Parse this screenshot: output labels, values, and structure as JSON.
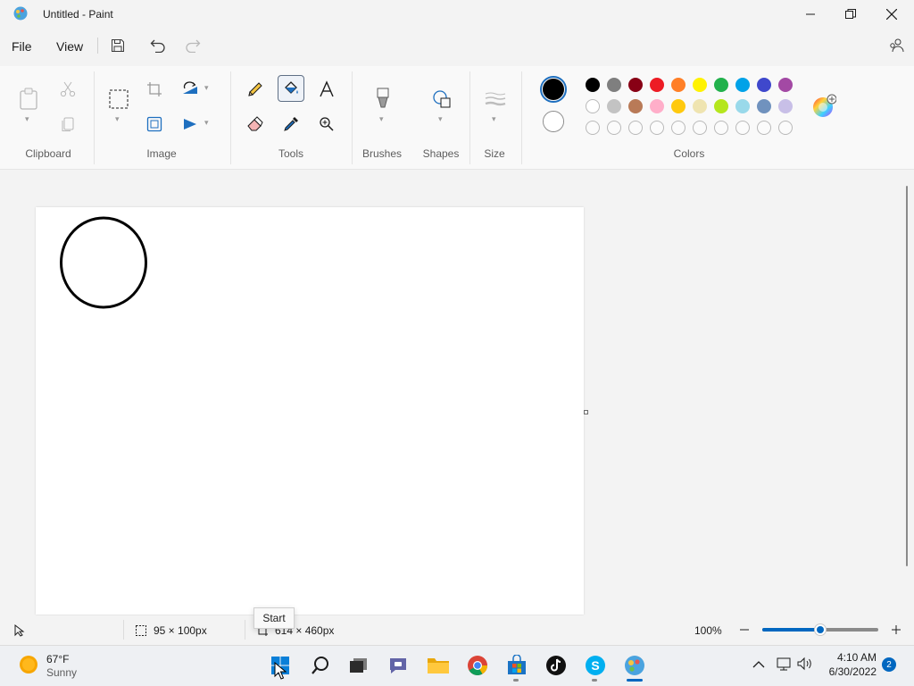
{
  "window": {
    "title": "Untitled - Paint",
    "controls": [
      "minimize",
      "maximize",
      "close"
    ]
  },
  "menu": {
    "file_label": "File",
    "view_label": "View"
  },
  "ribbon": {
    "groups": {
      "clipboard": "Clipboard",
      "image": "Image",
      "tools": "Tools",
      "brushes": "Brushes",
      "shapes": "Shapes",
      "size": "Size",
      "colors": "Colors"
    },
    "active_tool": "fill-bucket",
    "primary_color": "#000000",
    "secondary_color": "#ffffff",
    "palette_row1": [
      "#000000",
      "#7f7f7f",
      "#880015",
      "#ed1c24",
      "#ff7f27",
      "#fff200",
      "#22b14c",
      "#00a2e8",
      "#3f48cc",
      "#a349a4"
    ],
    "palette_row2": [
      "#ffffff",
      "#c3c3c3",
      "#b97a57",
      "#ffaec9",
      "#ffc90e",
      "#efe4b0",
      "#b5e61d",
      "#99d9ea",
      "#7092be",
      "#c8bfe7"
    ],
    "palette_row3_count": 10
  },
  "status": {
    "selection_size": "95 × 100px",
    "canvas_size": "614 × 460px",
    "zoom": "100%",
    "zoom_level_fraction": 0.5
  },
  "tooltip": {
    "text": "Start"
  },
  "taskbar": {
    "weather_temp": "67°F",
    "weather_desc": "Sunny",
    "time": "4:10 AM",
    "date": "6/30/2022",
    "notification_count": "2",
    "apps": [
      "start",
      "search",
      "task-view",
      "teams-chat",
      "file-explorer",
      "chrome",
      "microsoft-store",
      "tiktok",
      "skype",
      "paint"
    ]
  }
}
